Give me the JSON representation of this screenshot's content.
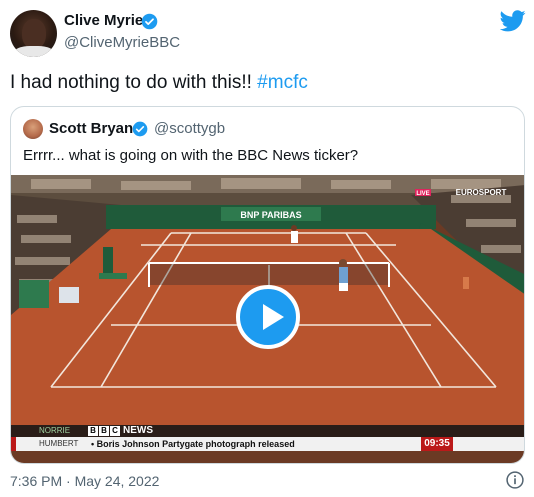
{
  "tweet": {
    "author_name": "Clive Myrie",
    "author_handle": "@CliveMyrieBBC",
    "text_main": "I had nothing to do with this!! ",
    "hashtag": "#mcfc",
    "timestamp": "7:36 PM · May 24, 2022"
  },
  "quote": {
    "author_name": "Scott Bryan",
    "author_handle": "@scottygb",
    "text": "Errrr... what is going on with the BBC News ticker?"
  },
  "video": {
    "banner_text": "BNP PARIBAS",
    "tv_tag": "LIVE",
    "channel_logo": "EUROSPORT",
    "ticker_left_top": "NORRIE",
    "ticker_left_bottom": "HUMBERT",
    "ticker_brand_letters": [
      "B",
      "B",
      "C"
    ],
    "ticker_brand_word": "NEWS",
    "ticker_headline": "Boris Johnson Partygate photograph released",
    "ticker_clock": "09:35",
    "play_icon": "play-icon"
  },
  "colors": {
    "accent": "#1d9bf0",
    "bbc_red": "#bb1919",
    "clay": "#b8542e"
  }
}
